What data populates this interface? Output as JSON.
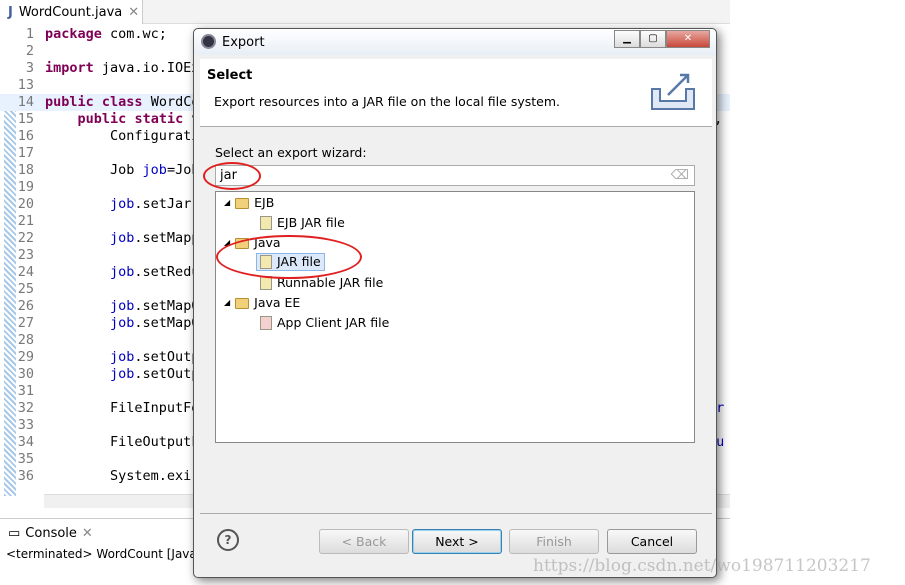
{
  "editor": {
    "tab": "WordCount.java",
    "lines": [
      {
        "n": "1",
        "t": "package com.wc;"
      },
      {
        "n": "2",
        "t": ""
      },
      {
        "n": "3",
        "t": "import java.io.IOEx"
      },
      {
        "n": "13",
        "t": ""
      },
      {
        "n": "14",
        "t": "public class WordCo"
      },
      {
        "n": "15",
        "t": "    public static v"
      },
      {
        "n": "16",
        "t": "        Configurati"
      },
      {
        "n": "17",
        "t": ""
      },
      {
        "n": "18",
        "t": "        Job job=Job"
      },
      {
        "n": "19",
        "t": ""
      },
      {
        "n": "20",
        "t": "        job.setJar"
      },
      {
        "n": "21",
        "t": ""
      },
      {
        "n": "22",
        "t": "        job.setMapp"
      },
      {
        "n": "23",
        "t": ""
      },
      {
        "n": "24",
        "t": "        job.setRedu"
      },
      {
        "n": "25",
        "t": ""
      },
      {
        "n": "26",
        "t": "        job.setMapO"
      },
      {
        "n": "27",
        "t": "        job.setMapO"
      },
      {
        "n": "28",
        "t": ""
      },
      {
        "n": "29",
        "t": "        job.setOutp"
      },
      {
        "n": "30",
        "t": "        job.setOutp"
      },
      {
        "n": "31",
        "t": ""
      },
      {
        "n": "32",
        "t": "        FileInputFo"
      },
      {
        "n": "33",
        "t": ""
      },
      {
        "n": "34",
        "t": "        FileOutputF"
      },
      {
        "n": "35",
        "t": ""
      },
      {
        "n": "36",
        "t": "        System.exi"
      }
    ],
    "right_fragments": [
      "n,",
      "ur",
      "ou"
    ]
  },
  "console": {
    "tab": "Console",
    "status": "<terminated> WordCount [Java"
  },
  "dialog": {
    "title": "Export",
    "section_title": "Select",
    "description": "Export resources into a JAR file on the local file system.",
    "wizard_label": "Select an export wizard:",
    "filter_value": "jar",
    "tree": [
      {
        "label": "EJB",
        "children": [
          "EJB JAR file"
        ]
      },
      {
        "label": "Java",
        "children": [
          "JAR file",
          "Runnable JAR file"
        ]
      },
      {
        "label": "Java EE",
        "children": [
          "App Client JAR file"
        ]
      }
    ],
    "selected": "JAR file",
    "buttons": {
      "back": "< Back",
      "next": "Next >",
      "finish": "Finish",
      "cancel": "Cancel",
      "help": "?"
    }
  },
  "watermark": "https://blog.csdn.net/wo198711203217"
}
